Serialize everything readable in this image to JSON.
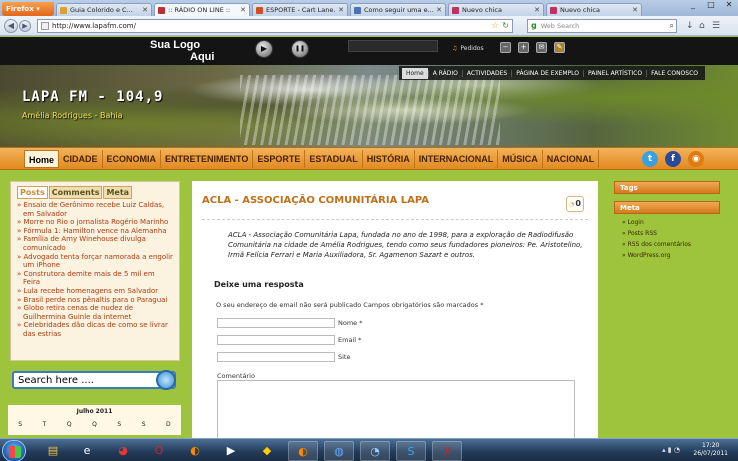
{
  "browser": {
    "app_button": "Firefox",
    "tabs": [
      {
        "label": "Guia Colorido e C...",
        "color": "#e0a030"
      },
      {
        "label": ":: RÁDIO ON LINE ::",
        "color": "#c03030",
        "active": true
      },
      {
        "label": "ESPORTE - Cart Lane...",
        "color": "#d05020"
      },
      {
        "label": "Como seguir uma e...",
        "color": "#5070b0"
      },
      {
        "label": "Nuevo chica",
        "color": "#c03060"
      },
      {
        "label": "Nuevo chica",
        "color": "#c03060"
      }
    ],
    "url": "http://www.lapafm.com/",
    "search_placeholder": "Web Search",
    "search_engine_icon": "g"
  },
  "radio": {
    "logo_line1": "Sua Logo",
    "logo_line2": "Aqui",
    "play_label": "▶",
    "pause_label": "❚❚",
    "pedidos_label": "Pedidos"
  },
  "site": {
    "title": "LAPA FM - 104,9",
    "subtitle": "Amélia Rodrigues - Bahia",
    "top_menu": [
      "Home",
      "A RÁDIO",
      "ACTIVIDADES",
      "PÁGINA DE EXEMPLO",
      "PAINEL ARTÍSTICO",
      "FALE CONOSCO"
    ],
    "main_menu": [
      "Home",
      "CIDADE",
      "ECONOMIA",
      "ENTRETENIMENTO",
      "ESPORTE",
      "ESTADUAL",
      "HISTÓRIA",
      "INTERNACIONAL",
      "MÚSICA",
      "NACIONAL"
    ],
    "social": [
      {
        "name": "twitter",
        "glyph": "t",
        "color": "#3aa0e0"
      },
      {
        "name": "facebook",
        "glyph": "f",
        "color": "#2a4a9a"
      },
      {
        "name": "rss",
        "glyph": "◉",
        "color": "#e07a10"
      }
    ]
  },
  "sidebar": {
    "tabs": [
      "Posts",
      "Comments",
      "Meta"
    ],
    "posts": [
      "Ensaio de Gerônimo recebe Luiz Caldas, em Salvador",
      "Morre no Rio o jornalista Rogério Marinho",
      "Fórmula 1: Hamilton vence na Alemanha",
      "Família de Amy Winehouse divulga comunicado",
      "Advogado tenta forçar namorada a engolir um iPhone",
      "Construtora demite mais de 5 mil em Feira",
      "Lula recebe homenagens em Salvador",
      "Brasil perde nos pênaltis para o Paraguai",
      "Globo retira cenas de nudez de Guilhermina Guinle da internet",
      "Celebridades dão dicas de como se livrar das estrias"
    ],
    "search_placeholder": "Search here ....",
    "calendar_caption": "Julho 2011",
    "calendar_days": [
      "S",
      "T",
      "Q",
      "Q",
      "S",
      "S",
      "D"
    ]
  },
  "article": {
    "title": "ACLA - ASSOCIAÇÃO COMUNITÁRIA LAPA",
    "comment_count": "0",
    "body": "ACLA - Associação Comunitária Lapa, fundada no ano de 1998, para a exploração de Radiodifusão Comunitária na cidade de Amélia Rodrigues, tendo como seus fundadores pioneiros: Pe. Aristotelino, Irmã Felícia Ferrari e Maria Auxiliadora, Sr. Agamenon Sazart e outros.",
    "reply_heading": "Deixe uma resposta",
    "required_note": "O seu endereço de email não será publicado Campos obrigatórios são marcados *",
    "fields": [
      {
        "label": "Nome *",
        "value": ""
      },
      {
        "label": "Email *",
        "value": ""
      },
      {
        "label": "Site",
        "value": ""
      }
    ],
    "comment_label": "Comentário"
  },
  "right_sidebar": {
    "tags_heading": "Tags",
    "meta_heading": "Meta",
    "meta_links": [
      "Login",
      "Posts RSS",
      "RSS dos comentários",
      "WordPress.org"
    ]
  },
  "taskbar": {
    "time": "17:20",
    "date": "26/07/2011",
    "items": [
      {
        "name": "explorer",
        "glyph": "▤"
      },
      {
        "name": "ie",
        "glyph": "e"
      },
      {
        "name": "chrome",
        "glyph": "◕"
      },
      {
        "name": "opera",
        "glyph": "O"
      },
      {
        "name": "firefox",
        "glyph": "◐"
      },
      {
        "name": "media",
        "glyph": "▶"
      },
      {
        "name": "app",
        "glyph": "◆"
      },
      {
        "name": "firefox-active",
        "glyph": "◐"
      },
      {
        "name": "network",
        "glyph": "◍"
      },
      {
        "name": "chat",
        "glyph": "◔"
      },
      {
        "name": "skype",
        "glyph": "S"
      },
      {
        "name": "excel",
        "glyph": "X"
      }
    ]
  }
}
